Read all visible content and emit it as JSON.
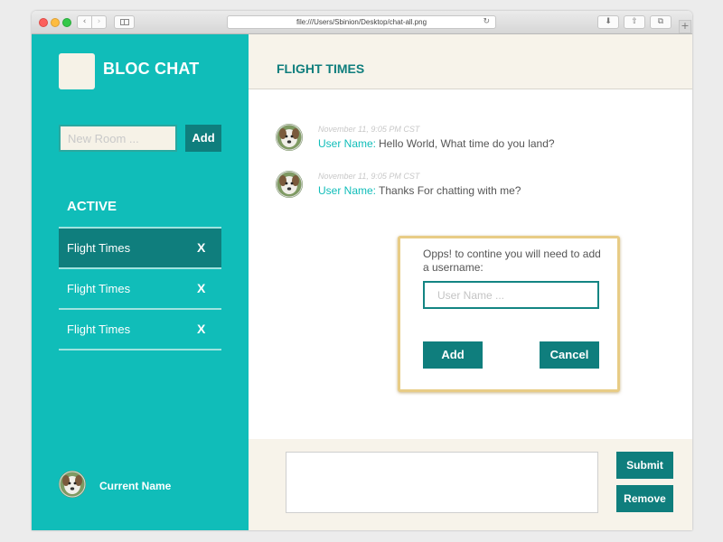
{
  "browser": {
    "url": "file:///Users/Sbinion/Desktop/chat-all.png",
    "back_icon": "‹",
    "forward_icon": "›",
    "reload_icon": "↻",
    "download_icon": "⬇",
    "share_icon": "⇧",
    "tabs_icon": "⧉",
    "new_tab_icon": "+"
  },
  "sidebar": {
    "brand": "BLOC CHAT",
    "new_room_placeholder": "New Room ...",
    "add_label": "Add",
    "active_heading": "ACTIVE",
    "rooms": [
      {
        "name": "Flight Times",
        "delete": "X",
        "selected": true
      },
      {
        "name": "Flight Times",
        "delete": "X",
        "selected": false
      },
      {
        "name": "Flight Times",
        "delete": "X",
        "selected": false
      }
    ],
    "current_user": "Current Name"
  },
  "main": {
    "room_title": "FLIGHT TIMES",
    "messages": [
      {
        "time": "November 11, 9:05 PM CST",
        "user": "User Name:",
        "text": "Hello World, What time do you land?"
      },
      {
        "time": "November 11, 9:05 PM CST",
        "user": "User Name:",
        "text": "Thanks For chatting with me?"
      }
    ]
  },
  "modal": {
    "message": "Opps! to contine you will need to add a username:",
    "username_placeholder": "User Name ...",
    "add_label": "Add",
    "cancel_label": "Cancel"
  },
  "composer": {
    "message_value": "",
    "submit_label": "Submit",
    "remove_label": "Remove"
  },
  "colors": {
    "sidebar_teal": "#10bdb9",
    "dark_teal": "#0f7e7d",
    "cream": "#f7f3ea",
    "modal_border": "#e8cc86"
  }
}
